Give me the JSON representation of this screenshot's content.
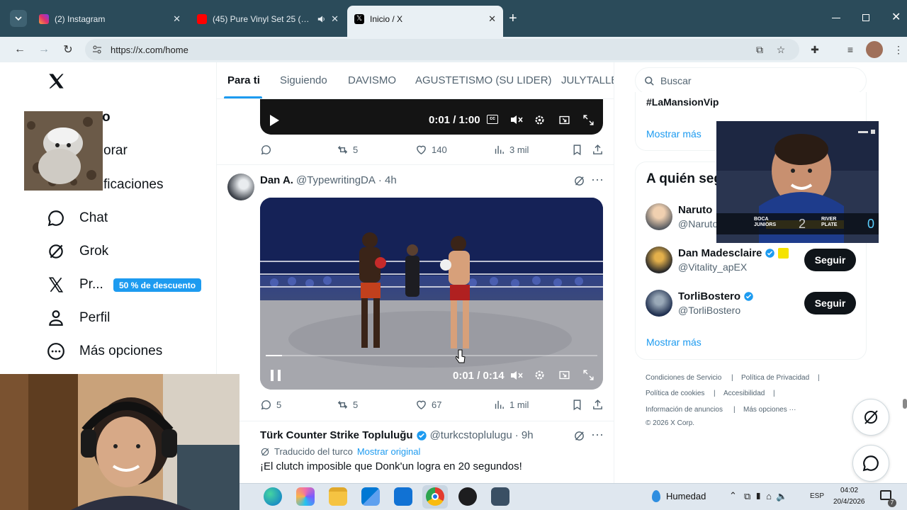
{
  "browser": {
    "tabs": [
      {
        "title": "(2) Instagram",
        "favicon": "instagram-icon"
      },
      {
        "title": "(45) Pure Vinyl Set 25 (Class",
        "favicon": "youtube-icon"
      },
      {
        "title": "Inicio / X",
        "favicon": "x-icon"
      }
    ],
    "url": "https://x.com/home",
    "close_glyph": "✕",
    "new_tab_glyph": "+"
  },
  "sidebar": {
    "items": [
      {
        "label": "o"
      },
      {
        "label": "orar"
      },
      {
        "label": "ficaciones"
      },
      {
        "label": "Chat"
      },
      {
        "label": "Grok"
      },
      {
        "label": "Pr..."
      },
      {
        "label": "Perfil"
      },
      {
        "label": "Más opciones"
      }
    ],
    "promo_badge": "50 % de descuento"
  },
  "feed": {
    "tabs": [
      "Para ti",
      "Siguiendo",
      "DAVISMO",
      "AGUSTETISMO (SU LIDER)",
      "JULYTALLER"
    ],
    "post1": {
      "time": "0:01 / 1:00",
      "retweets": "5",
      "likes": "140",
      "views": "3 mil"
    },
    "post2": {
      "name": "Dan A.",
      "handle": "@TypewritingDA",
      "age": "· 4h",
      "time": "0:01 / 0:14",
      "replies": "5",
      "retweets": "5",
      "likes": "67",
      "views": "1 mil",
      "progress": 0.05
    },
    "post3": {
      "name": "Türk Counter Strike Topluluğu",
      "handle": "@turkcstoplulugu",
      "age": "· 9h",
      "translated": "Traducido del turco",
      "show_original": "Mostrar original",
      "text": "¡El clutch imposible que Donk'un logra en 20 segundos!"
    }
  },
  "right": {
    "search_placeholder": "Buscar",
    "trend_tag": "#LaMansionVip",
    "show_more": "Mostrar más",
    "who_to_follow_title": "A quién seg",
    "accounts": [
      {
        "name": "Naruto",
        "handle": "@Naruto"
      },
      {
        "name": "Dan Madesclaire",
        "handle": "@Vitality_apEX",
        "button": "Seguir"
      },
      {
        "name": "TorliBostero",
        "handle": "@TorliBostero",
        "button": "Seguir"
      }
    ],
    "show_more2": "Mostrar más",
    "footer": [
      "Condiciones de Servicio",
      "|",
      "Política de Privacidad",
      "|",
      "Política de cookies",
      "|",
      "Accesibilidad",
      "|",
      "Información de anuncios",
      "|",
      "Más opciones ···",
      "© 2026 X Corp."
    ]
  },
  "pip": {
    "team1": "BOCA JUNIORS",
    "score1": "2",
    "team2": "RIVER PLATE",
    "score2": "0"
  },
  "taskbar": {
    "weather": "Humedad",
    "lang": "ESP",
    "time": "04:02",
    "date": "20/4/2026",
    "notif_count": "7"
  },
  "colors": {
    "accent": "#1d9bf0",
    "tabstrip": "#2b4b5a",
    "toolbar": "#e9f0f4",
    "text": "#0f1419",
    "muted": "#536471"
  }
}
